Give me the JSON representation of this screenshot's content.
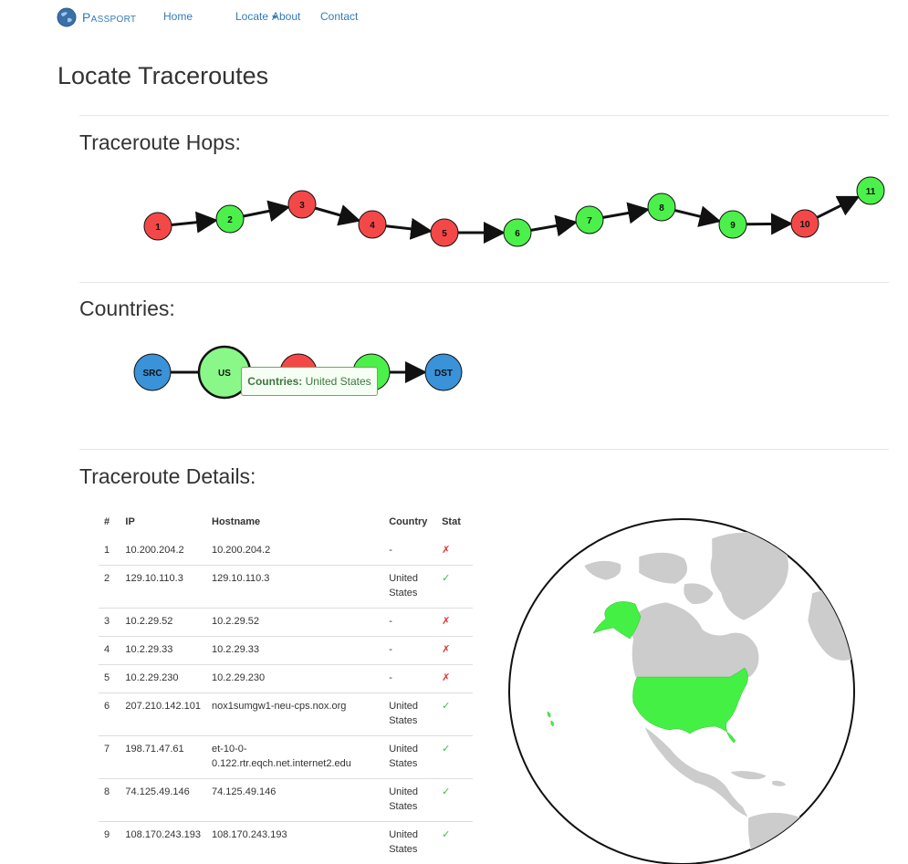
{
  "nav": {
    "brand": "Passport",
    "links": [
      "Home",
      "Locate",
      "About",
      "Contact"
    ]
  },
  "page_title": "Locate Traceroutes",
  "hops": {
    "title": "Traceroute Hops:",
    "nodes": [
      {
        "label": "1",
        "status": "red"
      },
      {
        "label": "2",
        "status": "green"
      },
      {
        "label": "3",
        "status": "red"
      },
      {
        "label": "4",
        "status": "red"
      },
      {
        "label": "5",
        "status": "red"
      },
      {
        "label": "6",
        "status": "green"
      },
      {
        "label": "7",
        "status": "green"
      },
      {
        "label": "8",
        "status": "green"
      },
      {
        "label": "9",
        "status": "green"
      },
      {
        "label": "10",
        "status": "red"
      },
      {
        "label": "11",
        "status": "green"
      }
    ]
  },
  "countries": {
    "title": "Countries:",
    "nodes": [
      {
        "label": "SRC",
        "kind": "endpoint"
      },
      {
        "label": "US",
        "kind": "country-highlighted"
      },
      {
        "label": "",
        "kind": "country-red"
      },
      {
        "label": "",
        "kind": "country-green"
      },
      {
        "label": "DST",
        "kind": "endpoint"
      }
    ],
    "tooltip": {
      "key": "Countries:",
      "value": "United States"
    }
  },
  "details": {
    "title": "Traceroute Details:",
    "headers": [
      "#",
      "IP",
      "Hostname",
      "Country",
      "Stat"
    ],
    "rows": [
      {
        "num": "1",
        "ip": "10.200.204.2",
        "host": "10.200.204.2",
        "country": "-",
        "status": "✗"
      },
      {
        "num": "2",
        "ip": "129.10.110.3",
        "host": "129.10.110.3",
        "country": "United States",
        "status": "✓"
      },
      {
        "num": "3",
        "ip": "10.2.29.52",
        "host": "10.2.29.52",
        "country": "-",
        "status": "✗"
      },
      {
        "num": "4",
        "ip": "10.2.29.33",
        "host": "10.2.29.33",
        "country": "-",
        "status": "✗"
      },
      {
        "num": "5",
        "ip": "10.2.29.230",
        "host": "10.2.29.230",
        "country": "-",
        "status": "✗"
      },
      {
        "num": "6",
        "ip": "207.210.142.101",
        "host": "nox1sumgw1-neu-cps.nox.org",
        "country": "United States",
        "status": "✓"
      },
      {
        "num": "7",
        "ip": "198.71.47.61",
        "host": "et-10-0-0.122.rtr.eqch.net.internet2.edu",
        "country": "United States",
        "status": "✓"
      },
      {
        "num": "8",
        "ip": "74.125.49.146",
        "host": "74.125.49.146",
        "country": "United States",
        "status": "✓"
      },
      {
        "num": "9",
        "ip": "108.170.243.193",
        "host": "108.170.243.193",
        "country": "United States",
        "status": "✓"
      }
    ]
  },
  "colors": {
    "link": "#337ab7",
    "hop_red": "#f44848",
    "hop_green": "#4cf04a",
    "endpoint_blue": "#3a92d8",
    "map_land": "#cccccc",
    "map_highlight": "#44f044",
    "status_ok": "#3bbf3b",
    "status_bad": "#e03232"
  }
}
